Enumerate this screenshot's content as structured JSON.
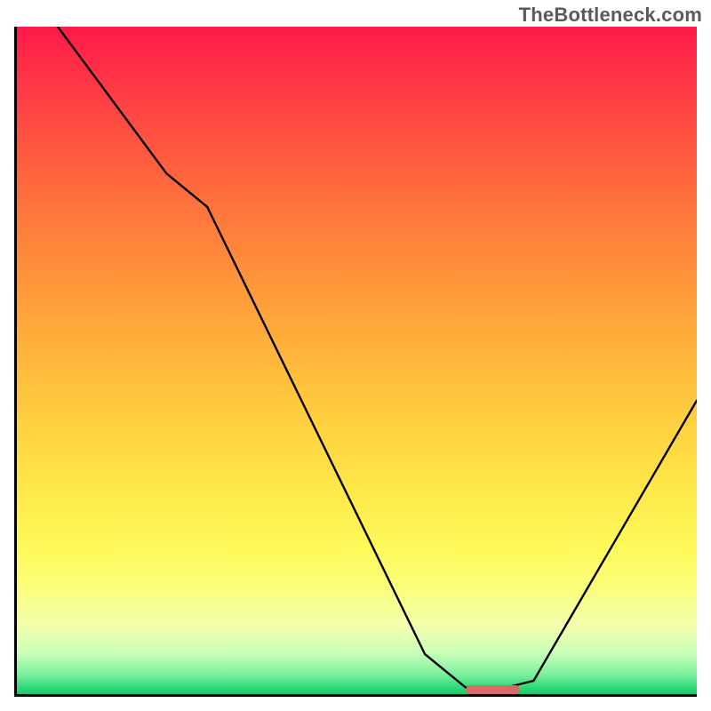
{
  "watermark": "TheBottleneck.com",
  "chart_data": {
    "type": "line",
    "title": "",
    "xlabel": "",
    "ylabel": "",
    "xlim": [
      0,
      100
    ],
    "ylim": [
      0,
      100
    ],
    "grid": false,
    "series": [
      {
        "name": "bottleneck-curve",
        "x": [
          0,
          6,
          22,
          28,
          60,
          66,
          72,
          76,
          100
        ],
        "values": [
          105,
          100,
          78,
          73,
          6,
          1,
          1,
          2,
          44
        ]
      }
    ],
    "optimal_marker": {
      "x_start": 66,
      "x_end": 74,
      "y": 0.7
    },
    "colors": {
      "gradient_top": "#ff1a48",
      "gradient_mid": "#ffd240",
      "gradient_bottom": "#18c96c",
      "curve": "#000000",
      "marker": "#d86a6a",
      "axis": "#000000"
    }
  }
}
